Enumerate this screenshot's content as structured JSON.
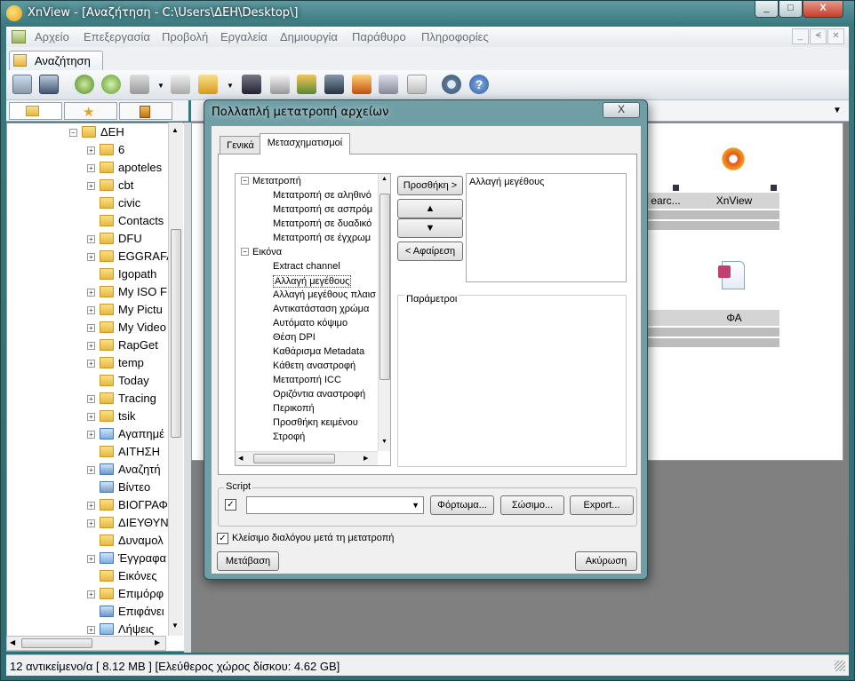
{
  "app": {
    "title": "XnView - [Αναζήτηση - C:\\Users\\ΔΕΗ\\Desktop\\]"
  },
  "window_controls": {
    "minimize": "_",
    "maximize": "□",
    "close": "X",
    "mdi_min": "_",
    "mdi_restore": "ᗕ",
    "mdi_close": "✕"
  },
  "menu": [
    "Αρχείο",
    "Επεξεργασία",
    "Προβολή",
    "Εργαλεία",
    "Δημιουργία",
    "Παράθυρο",
    "Πληροφορίες"
  ],
  "tab": {
    "label": "Αναζήτηση"
  },
  "tree": {
    "root": "ΔΕΗ",
    "items": [
      {
        "label": "6",
        "expand": true
      },
      {
        "label": "apoteles",
        "expand": true
      },
      {
        "label": "cbt",
        "expand": true
      },
      {
        "label": "civic",
        "expand": false
      },
      {
        "label": "Contacts",
        "expand": false
      },
      {
        "label": "DFU",
        "expand": true
      },
      {
        "label": "EGGRAFA",
        "expand": true
      },
      {
        "label": "Igopath",
        "expand": false
      },
      {
        "label": "My ISO F",
        "expand": true
      },
      {
        "label": "My Pictu",
        "expand": true
      },
      {
        "label": "My Video",
        "expand": true
      },
      {
        "label": "RapGet",
        "expand": true
      },
      {
        "label": "temp",
        "expand": true
      },
      {
        "label": "Today",
        "expand": false
      },
      {
        "label": "Tracing",
        "expand": true
      },
      {
        "label": "tsik",
        "expand": true
      },
      {
        "label": "Αγαπημέ",
        "expand": true
      },
      {
        "label": "ΑΙΤΗΣΗ",
        "expand": false
      },
      {
        "label": "Αναζητή",
        "expand": true
      },
      {
        "label": "Βίντεο",
        "expand": false
      },
      {
        "label": "ΒΙΟΓΡΑΦ",
        "expand": true
      },
      {
        "label": "ΔΙΕΥΘΥΝ",
        "expand": true
      },
      {
        "label": "Δυναμολ",
        "expand": false
      },
      {
        "label": "Έγγραφα",
        "expand": true
      },
      {
        "label": "Εικόνες",
        "expand": false
      },
      {
        "label": "Επιμόρφ",
        "expand": true
      },
      {
        "label": "Επιφάνει",
        "expand": false
      },
      {
        "label": "Λήψεις",
        "expand": true
      }
    ]
  },
  "thumbs": [
    {
      "label": "earc...",
      "tile": "search-tile"
    },
    {
      "label": "XnView",
      "tile": "xnview-tile"
    },
    {
      "label": "ΦΑ",
      "tile": "document-tile"
    }
  ],
  "status": {
    "text": "12 αντικείμενο/α [ 8.12 MB ] [Ελεύθερος χώρος δίσκου: 4.62 GB]"
  },
  "dialog": {
    "title": "Πολλαπλή μετατροπή αρχείων",
    "close": "X",
    "tabs": [
      "Γενικά",
      "Μετασχηματισμοί"
    ],
    "tree_groups": [
      {
        "label": "Μετατροπή",
        "children": [
          "Μετατροπή σε αληθινό",
          "Μετατροπή σε ασπρόμ",
          "Μετατροπή σε δυαδικό",
          "Μετατροπή σε έγχρωμ"
        ]
      },
      {
        "label": "Εικόνα",
        "children": [
          "Extract channel",
          "Αλλαγή μεγέθους",
          "Αλλαγή μεγέθους πλαισ",
          "Αντικατάσταση χρώμα",
          "Αυτόματο κόψιμο",
          "Θέση DPI",
          "Καθάρισμα Metadata",
          "Κάθετη αναστροφή",
          "Μετατροπή ICC",
          "Οριζόντια αναστροφή",
          "Περικοπή",
          "Προσθήκη κειμένου",
          "Στροφή"
        ]
      }
    ],
    "add_button": "Προσθήκη >",
    "up_arrow": "▲",
    "down_arrow": "▼",
    "remove_button": "< Αφαίρεση",
    "selected_list": [
      "Αλλαγή μεγέθους"
    ],
    "params_label": "Παράμετροι",
    "script_label": "Script",
    "script_value": "",
    "load_button": "Φόρτωμα...",
    "save_button": "Σώσιμο...",
    "export_button": "Export...",
    "close_after_label": "Κλείσιμο διαλόγου μετά τη μετατροπή",
    "go_button": "Μετάβαση",
    "cancel_button": "Ακύρωση"
  }
}
